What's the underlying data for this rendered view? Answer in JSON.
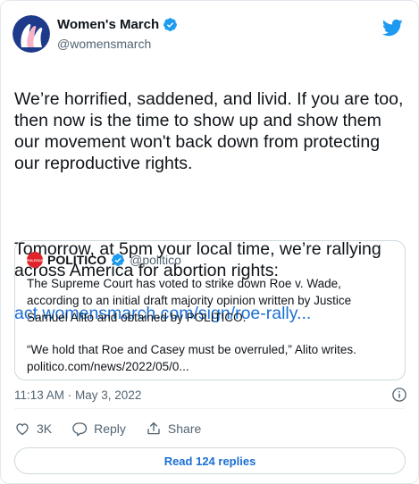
{
  "author": {
    "name": "Women's March",
    "handle": "@womensmarch",
    "avatar_icon": "womens-march-logo",
    "verified": true
  },
  "brand_icon": "twitter-bird-icon",
  "tweet": {
    "paragraph1": "We’re horrified, saddened, and livid. If you are too, then now is the time to show up and show them our movement won't back down from protecting our reproductive rights.",
    "paragraph2": "Tomorrow, at 5pm your local time, we’re rallying across America for abortion rights:",
    "link": "act.womensmarch.com/sign/roe-rally..."
  },
  "quote": {
    "name": "POLITICO",
    "handle": "@politico",
    "logo_text": "POLITICO",
    "verified": true,
    "paragraph1": "The Supreme Court has voted to strike down Roe v. Wade, according to an initial draft majority opinion written by Justice Samuel Alito and obtained by POLITICO.",
    "paragraph2": "“We hold that Roe and Casey must be overruled,” Alito writes.",
    "link": "politico.com/news/2022/05/0..."
  },
  "meta": {
    "timestamp": "11:13 AM · May 3, 2022",
    "info_icon": "info-icon"
  },
  "actions": {
    "likes": "3K",
    "reply_label": "Reply",
    "share_label": "Share"
  },
  "replies_button": "Read 124 replies",
  "colors": {
    "link": "#1b6fd3",
    "verified": "#1d9bf0",
    "twitter": "#1d9bf0",
    "politico": "#e0242a",
    "muted": "#536471"
  }
}
